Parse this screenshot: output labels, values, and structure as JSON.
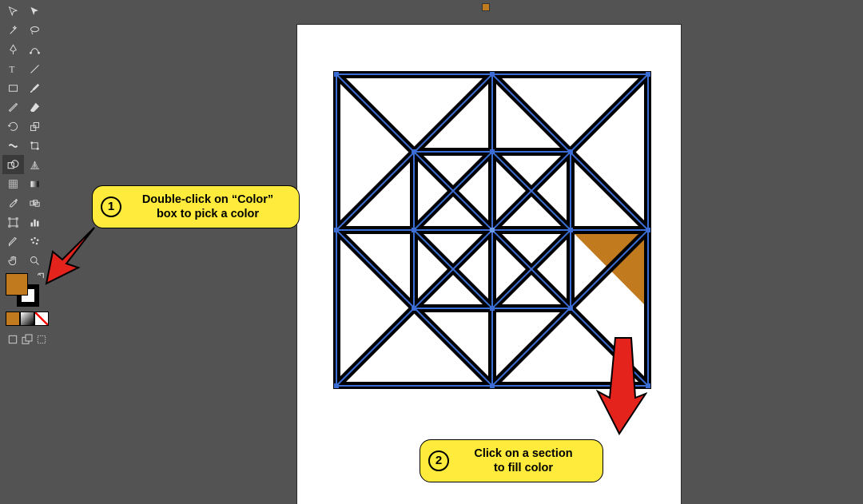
{
  "colors": {
    "fill": "#c17a1e",
    "stroke": "#000000",
    "selection": "#3b6dd4",
    "artboard_bg": "#ffffff",
    "workspace_bg": "#535353",
    "callout_bg": "#ffeb3b",
    "arrow": "#e3231c"
  },
  "tools": {
    "left_column": [
      "selection",
      "direct-selection",
      "pen",
      "type",
      "line",
      "rectangle",
      "paintbrush",
      "rotate",
      "width",
      "shape-builder",
      "mesh",
      "eyedropper",
      "artboard",
      "slice",
      "hand"
    ],
    "right_column": [
      "magic-wand",
      "lasso",
      "curvature",
      "eraser",
      "shaper",
      "scissors",
      "scale",
      "free-transform",
      "perspective-grid",
      "column-graph",
      "gradient",
      "blend",
      "measure",
      "symbol-sprayer",
      "zoom"
    ]
  },
  "fill_stroke": {
    "fill_value": "#c17a1e",
    "stroke_value": "#000000",
    "mini": [
      "solid",
      "gradient",
      "none"
    ]
  },
  "callouts": {
    "one": {
      "num": "1",
      "line1": "Double-click on “Color”",
      "line2": "box to pick a color"
    },
    "two": {
      "num": "2",
      "line1": "Click on a section",
      "line2": "to fill color"
    }
  },
  "quilt": {
    "outer": 390,
    "mid_in": 98,
    "inner": 195,
    "filled_triangle": "bottom-right-outer-right"
  }
}
